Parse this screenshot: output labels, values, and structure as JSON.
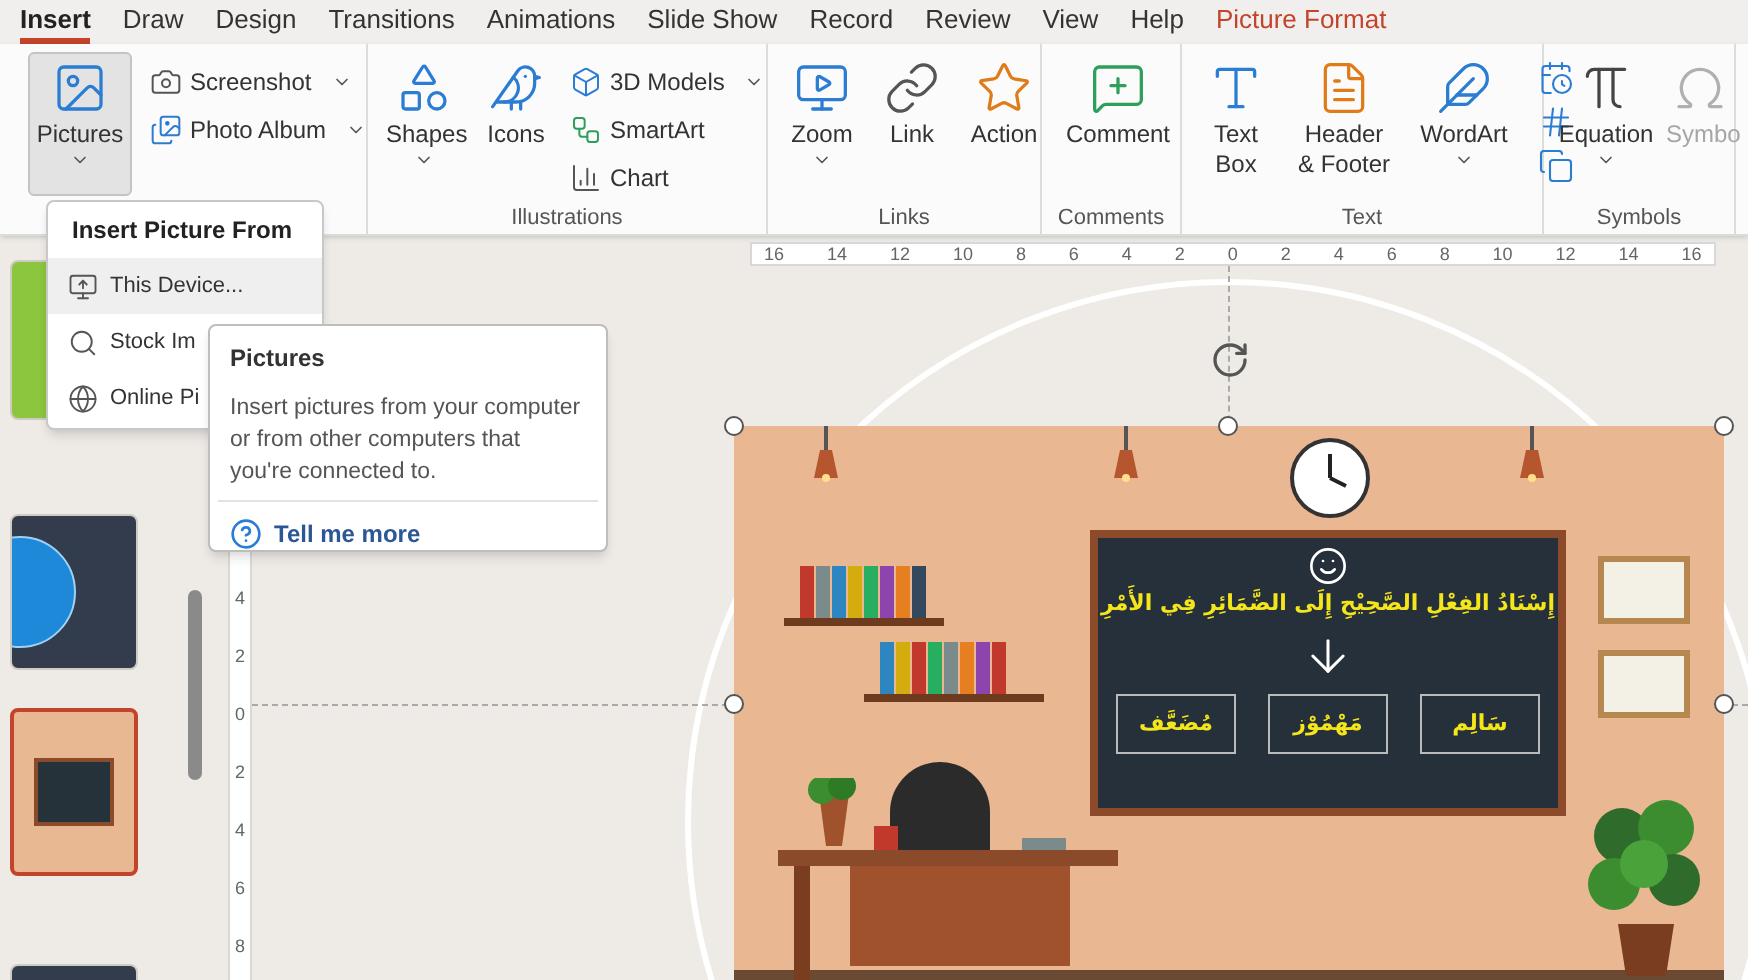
{
  "tabs": [
    {
      "label": "Insert",
      "selected": true,
      "kind": "standard"
    },
    {
      "label": "Draw",
      "selected": false,
      "kind": "standard"
    },
    {
      "label": "Design",
      "selected": false,
      "kind": "standard"
    },
    {
      "label": "Transitions",
      "selected": false,
      "kind": "standard"
    },
    {
      "label": "Animations",
      "selected": false,
      "kind": "standard"
    },
    {
      "label": "Slide Show",
      "selected": false,
      "kind": "standard"
    },
    {
      "label": "Record",
      "selected": false,
      "kind": "standard"
    },
    {
      "label": "Review",
      "selected": false,
      "kind": "standard"
    },
    {
      "label": "View",
      "selected": false,
      "kind": "standard"
    },
    {
      "label": "Help",
      "selected": false,
      "kind": "standard"
    },
    {
      "label": "Picture Format",
      "selected": false,
      "kind": "contextual"
    }
  ],
  "ribbon": {
    "groups": [
      {
        "commands": [
          {
            "label": "Pictures",
            "kind": "large",
            "dropdown": true,
            "pressed": true,
            "disabled": false
          },
          {
            "label": "Screenshot",
            "kind": "small",
            "dropdown": true,
            "pressed": false,
            "disabled": false
          },
          {
            "label": "Photo Album",
            "kind": "small",
            "dropdown": true,
            "pressed": false,
            "disabled": false
          }
        ]
      },
      {
        "label": "Illustrations",
        "commands": [
          {
            "label": "Shapes",
            "kind": "large",
            "dropdown": true,
            "pressed": false,
            "disabled": false
          },
          {
            "label": "Icons",
            "kind": "large",
            "dropdown": false,
            "pressed": false,
            "disabled": false
          },
          {
            "label": "3D Models",
            "kind": "small",
            "dropdown": true,
            "pressed": false,
            "disabled": false
          },
          {
            "label": "SmartArt",
            "kind": "small",
            "dropdown": false,
            "pressed": false,
            "disabled": false
          },
          {
            "label": "Chart",
            "kind": "small",
            "dropdown": false,
            "pressed": false,
            "disabled": false
          }
        ]
      },
      {
        "label": "Links",
        "commands": [
          {
            "label": "Zoom",
            "kind": "large",
            "dropdown": true,
            "pressed": false,
            "disabled": false
          },
          {
            "label": "Link",
            "kind": "large",
            "dropdown": false,
            "pressed": false,
            "disabled": false
          },
          {
            "label": "Action",
            "kind": "large",
            "dropdown": false,
            "pressed": false,
            "disabled": false
          }
        ]
      },
      {
        "label": "Comments",
        "commands": [
          {
            "label": "Comment",
            "kind": "large",
            "dropdown": false,
            "pressed": false,
            "disabled": false
          }
        ]
      },
      {
        "label": "Text",
        "commands": [
          {
            "label": "Text Box",
            "kind": "large",
            "dropdown": false,
            "pressed": false,
            "disabled": false
          },
          {
            "label": "Header & Footer",
            "kind": "large",
            "dropdown": false,
            "pressed": false,
            "disabled": false
          },
          {
            "label": "WordArt",
            "kind": "large",
            "dropdown": true,
            "pressed": false,
            "disabled": false
          }
        ]
      },
      {
        "label": "Symbols",
        "commands": [
          {
            "label": "Equation",
            "kind": "large",
            "dropdown": true,
            "pressed": false,
            "disabled": false
          },
          {
            "label": "Symbo",
            "kind": "large",
            "dropdown": false,
            "pressed": false,
            "disabled": true
          }
        ]
      }
    ]
  },
  "slides": [
    {
      "kind": "green",
      "selected": false
    },
    {
      "kind": "title",
      "selected": false
    },
    {
      "kind": "classroom",
      "selected": true
    },
    {
      "kind": "title",
      "selected": false
    }
  ],
  "rulers": {
    "horizontal": [
      "16",
      "14",
      "12",
      "10",
      "8",
      "6",
      "4",
      "2",
      "0",
      "2",
      "4",
      "6",
      "8",
      "10",
      "12",
      "14",
      "16"
    ],
    "vertical": [
      "4",
      "2",
      "0",
      "2",
      "4",
      "6",
      "8"
    ]
  },
  "slide": {
    "title": "إِسْنَادُ الفِعْلِ الصَّحِيْحِ إِلَى الضَّمَائِرِ فِي الأَمْرِ",
    "options": [
      "سَالِم",
      "مَهْمُوْز",
      "مُضَعَّف"
    ]
  },
  "menu": {
    "title": "Insert Picture From",
    "items": [
      {
        "label": "This Device...",
        "selected": true
      },
      {
        "label": "Stock Im",
        "selected": false
      },
      {
        "label": "Online Pi",
        "selected": false
      }
    ]
  },
  "tooltip": {
    "title": "Pictures",
    "description": "Insert pictures from your computer or from other computers that you're connected to.",
    "link": "Tell me more"
  }
}
